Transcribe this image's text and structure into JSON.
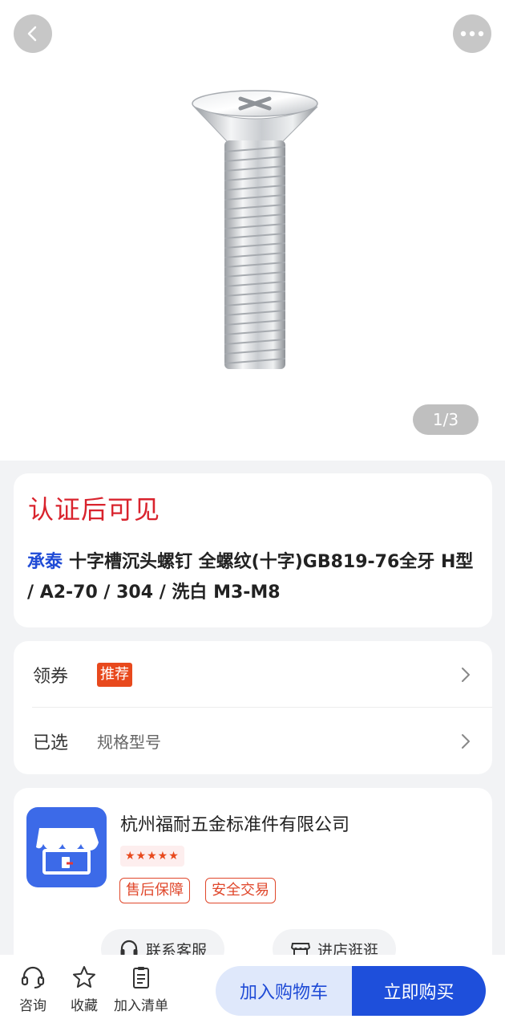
{
  "gallery": {
    "pager": "1/3",
    "image_icon": "screw-product-image"
  },
  "product": {
    "price_hint": "认证后可见",
    "brand": "承泰",
    "title": "承泰 十字槽沉头螺钉 全螺纹(十字)GB819-76全牙 H型 / A2-70 / 304 / 洗白 M3-M8"
  },
  "options": {
    "coupon_label": "领券",
    "coupon_badge": "推荐",
    "selected_label": "已选",
    "selected_value": "规格型号"
  },
  "store": {
    "name": "杭州福耐五金标准件有限公司",
    "rating_stars": "★★★★★",
    "rating_value": 5,
    "tags": [
      "售后保障",
      "安全交易"
    ],
    "contact_label": "联系客服",
    "visit_label": "进店逛逛"
  },
  "bottom_bar": {
    "consult": "咨询",
    "favorite": "收藏",
    "add_list": "加入清单",
    "add_cart": "加入购物车",
    "buy_now": "立即购买"
  },
  "colors": {
    "accent_blue": "#1e4fdb",
    "price_red": "#d9232d",
    "badge_orange": "#e8491d"
  }
}
